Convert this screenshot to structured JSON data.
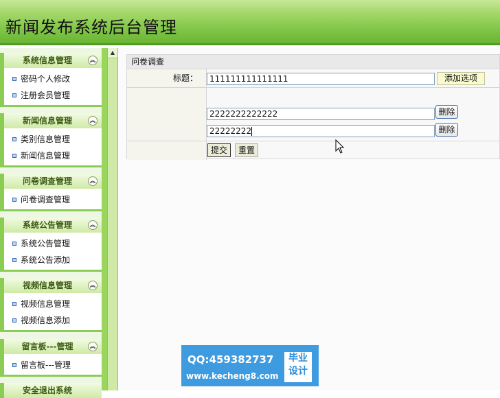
{
  "header": {
    "title": "新闻发布系统后台管理"
  },
  "sidebar": {
    "groups": [
      {
        "title": "系统信息管理",
        "items": [
          "密码个人修改",
          "注册会员管理"
        ]
      },
      {
        "title": "新闻信息管理",
        "items": [
          "类别信息管理",
          "新闻信息管理"
        ]
      },
      {
        "title": "问卷调查管理",
        "items": [
          "问卷调查管理"
        ]
      },
      {
        "title": "系统公告管理",
        "items": [
          "系统公告管理",
          "系统公告添加"
        ]
      },
      {
        "title": "视频信息管理",
        "items": [
          "视频信息管理",
          "视频信息添加"
        ]
      },
      {
        "title": "留言板---管理",
        "items": [
          "留言板---管理"
        ]
      },
      {
        "title": "安全退出系统",
        "items": []
      }
    ],
    "collapse_icon": "double-chevron-up-icon"
  },
  "main": {
    "panel_title": "问卷调查",
    "title_label": "标题：",
    "title_value": "111111111111111",
    "add_option_label": "添加选项",
    "options": [
      {
        "value": "2222222222222",
        "delete_label": "删除"
      },
      {
        "value": "22222222",
        "delete_label": "删除"
      }
    ],
    "submit_label": "提交",
    "reset_label": "重置"
  },
  "watermark": {
    "qq": "QQ:459382737",
    "url": "www.kecheng8.com",
    "badge_line1": "毕业",
    "badge_line2": "设计"
  }
}
